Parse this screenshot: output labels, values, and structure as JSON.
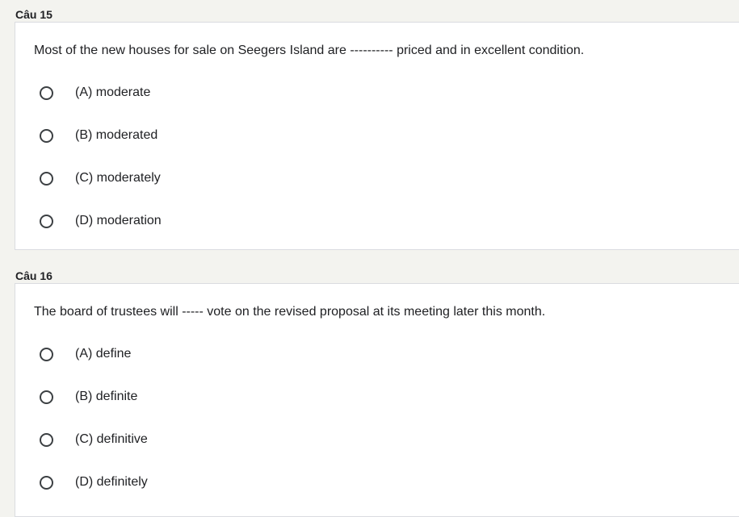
{
  "questions": [
    {
      "label": "Câu 15",
      "text": "Most of the new houses for sale on Seegers Island are ---------- priced and in excellent condition.",
      "options": [
        {
          "label": "(A) moderate",
          "selected": false
        },
        {
          "label": "(B) moderated",
          "selected": false
        },
        {
          "label": "(C) moderately",
          "selected": false
        },
        {
          "label": "(D) moderation",
          "selected": false
        }
      ]
    },
    {
      "label": "Câu 16",
      "text": "The board of trustees will ----- vote on the revised proposal at its meeting later this month.",
      "options": [
        {
          "label": "(A) define",
          "selected": false
        },
        {
          "label": "(B) definite",
          "selected": false
        },
        {
          "label": "(C) definitive",
          "selected": false
        },
        {
          "label": "(D) definitely",
          "selected": false
        }
      ]
    }
  ]
}
